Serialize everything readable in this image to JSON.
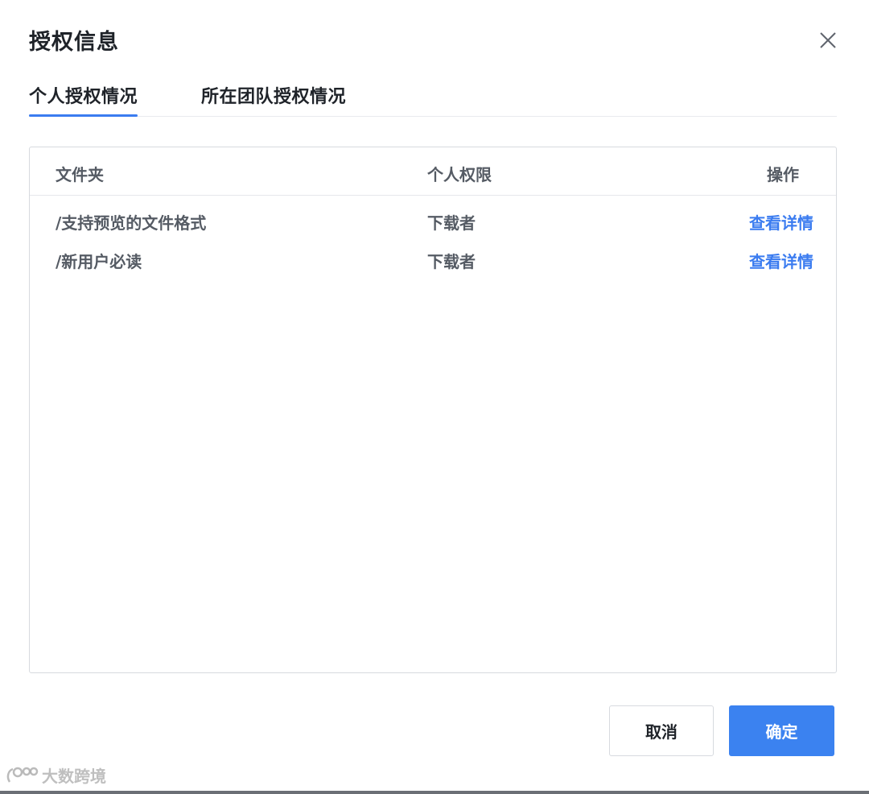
{
  "dialog": {
    "title": "授权信息",
    "close_icon": "close-icon"
  },
  "tabs": [
    {
      "label": "个人授权情况",
      "active": true
    },
    {
      "label": "所在团队授权情况",
      "active": false
    }
  ],
  "table": {
    "headers": {
      "folder": "文件夹",
      "permission": "个人权限",
      "action": "操作"
    },
    "rows": [
      {
        "folder": "/支持预览的文件格式",
        "permission": "下载者",
        "action": "查看详情"
      },
      {
        "folder": "/新用户必读",
        "permission": "下载者",
        "action": "查看详情"
      }
    ]
  },
  "footer": {
    "cancel_label": "取消",
    "ok_label": "确定"
  },
  "watermark": {
    "text": "大数跨境"
  },
  "colors": {
    "accent": "#3b82f0",
    "link": "#3b7cf0",
    "text": "#1f2329",
    "muted": "#555b64",
    "border": "#d7dadf"
  }
}
